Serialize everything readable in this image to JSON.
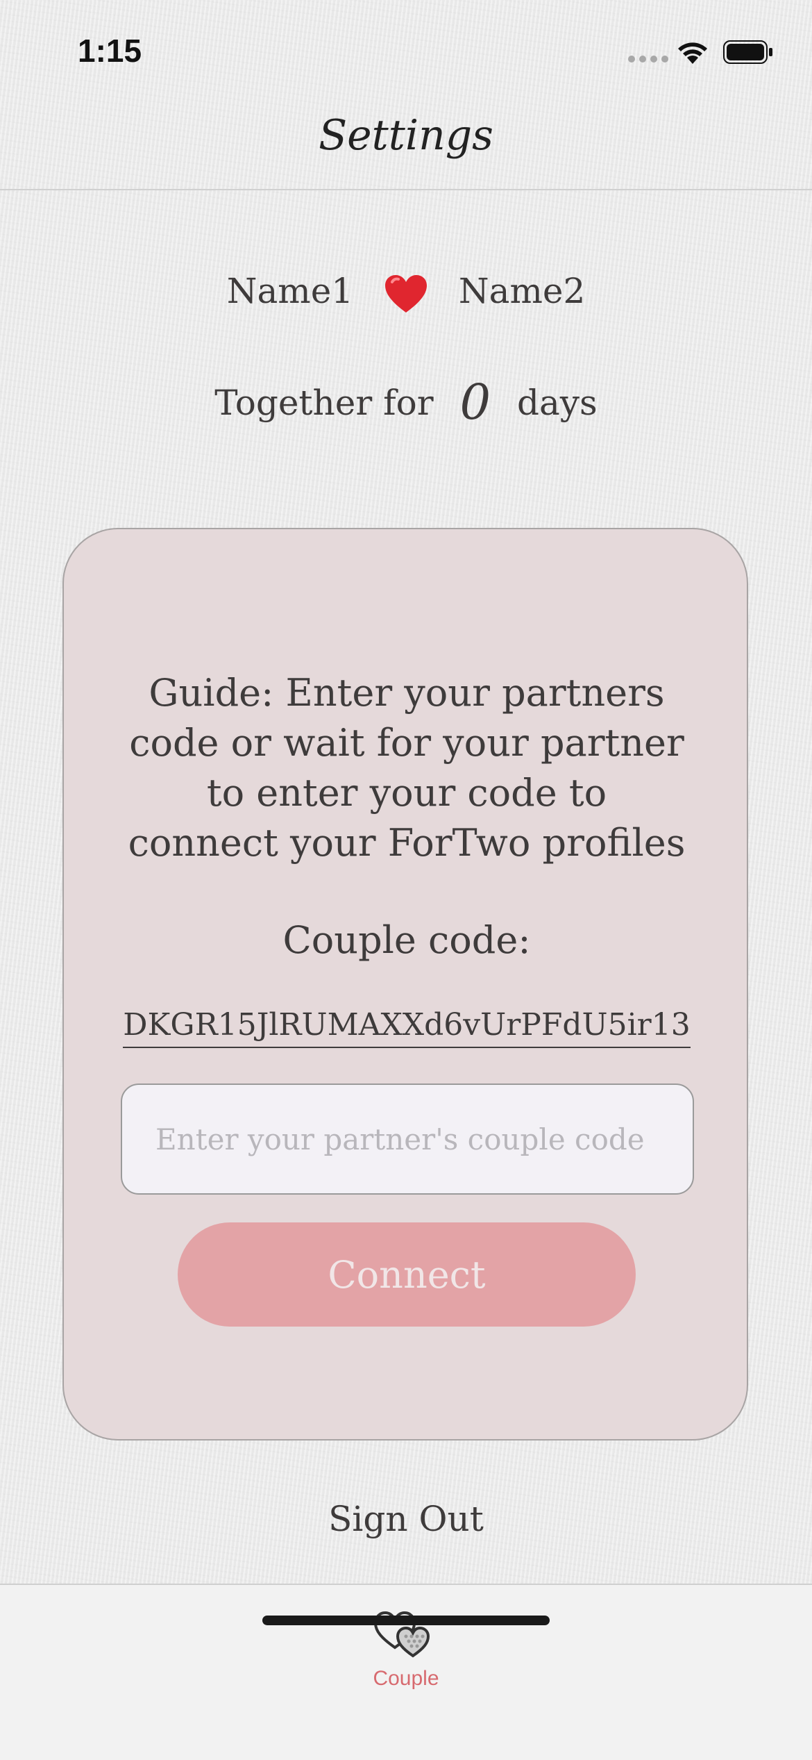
{
  "status_bar": {
    "time": "1:15"
  },
  "nav": {
    "title": "Settings"
  },
  "couple": {
    "name1": "Name1",
    "name2": "Name2",
    "together_prefix": "Together for",
    "days": "0",
    "days_suffix": "days"
  },
  "card": {
    "guide": "Guide: Enter your partners code or wait for your partner to enter your code to connect your ForTwo profiles",
    "code_label": "Couple code:",
    "code_value": "DKGR15JlRUMAXXd6vUrPFdU5ir13",
    "input_placeholder": "Enter your partner's couple code",
    "input_value": "",
    "connect_label": "Connect"
  },
  "sign_out_label": "Sign Out",
  "tab_bar": {
    "items": [
      {
        "label": "Couple",
        "icon": "two-hearts-icon",
        "active": true
      }
    ]
  },
  "colors": {
    "accent": "#d76a6f",
    "card": "#e5d9da",
    "button": "#e3a3a6"
  }
}
